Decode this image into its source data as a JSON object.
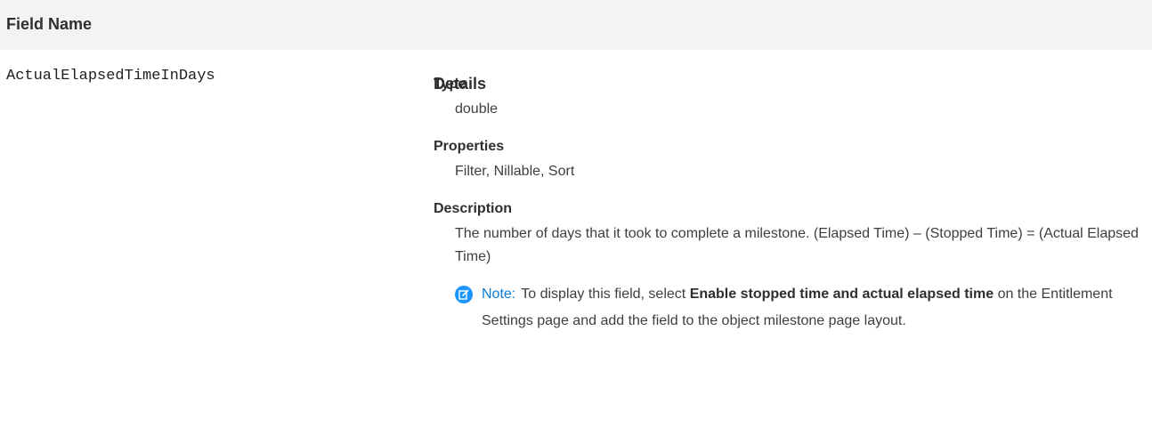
{
  "table": {
    "header_field": "Field Name",
    "header_details": "Details"
  },
  "field": {
    "name": "ActualElapsedTimeInDays",
    "type_label": "Type",
    "type_value": "double",
    "properties_label": "Properties",
    "properties_value": "Filter, Nillable, Sort",
    "description_label": "Description",
    "description_value": "The number of days that it took to complete a milestone. (Elapsed Time) – (Stopped Time) = (Actual Elapsed Time)"
  },
  "note": {
    "label": "Note:",
    "text_before": "To display this field, select",
    "bold_text": "Enable stopped time and actual elapsed time",
    "text_after": "on the Entitlement Settings page and add the field to the object milestone page layout.",
    "icon": "edit-note-icon",
    "icon_color": "#1b96ff"
  }
}
